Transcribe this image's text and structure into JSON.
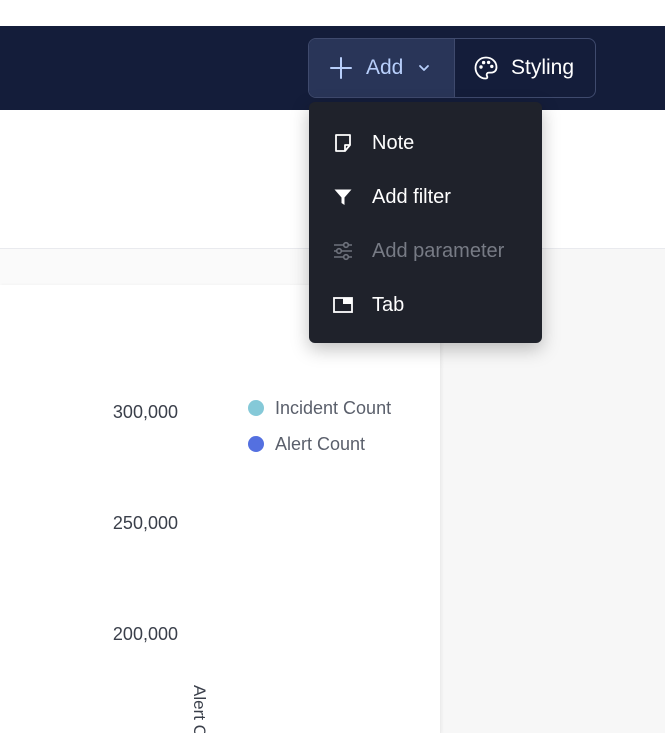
{
  "toolbar": {
    "add_label": "Add",
    "styling_label": "Styling"
  },
  "add_menu": {
    "items": [
      {
        "label": "Note",
        "icon": "note-icon",
        "enabled": true
      },
      {
        "label": "Add filter",
        "icon": "filter-icon",
        "enabled": true
      },
      {
        "label": "Add parameter",
        "icon": "sliders-icon",
        "enabled": false
      },
      {
        "label": "Tab",
        "icon": "tab-icon",
        "enabled": true
      }
    ]
  },
  "chart_data": {
    "type": "line",
    "title": "",
    "ylabel": "Alert C",
    "y_ticks": [
      300000,
      250000,
      200000
    ],
    "y_tick_labels": [
      "300,000",
      "250,000",
      "200,000"
    ],
    "legend_position": "top-right",
    "series": [
      {
        "name": "Incident Count",
        "color": "#85c9d8",
        "values": []
      },
      {
        "name": "Alert Count",
        "color": "#5470e0",
        "values": []
      }
    ]
  },
  "colors": {
    "topbar": "#141d3a",
    "add_button_bg": "#293558",
    "menu_bg": "#1f222b",
    "accent_text": "#b8cffb"
  }
}
